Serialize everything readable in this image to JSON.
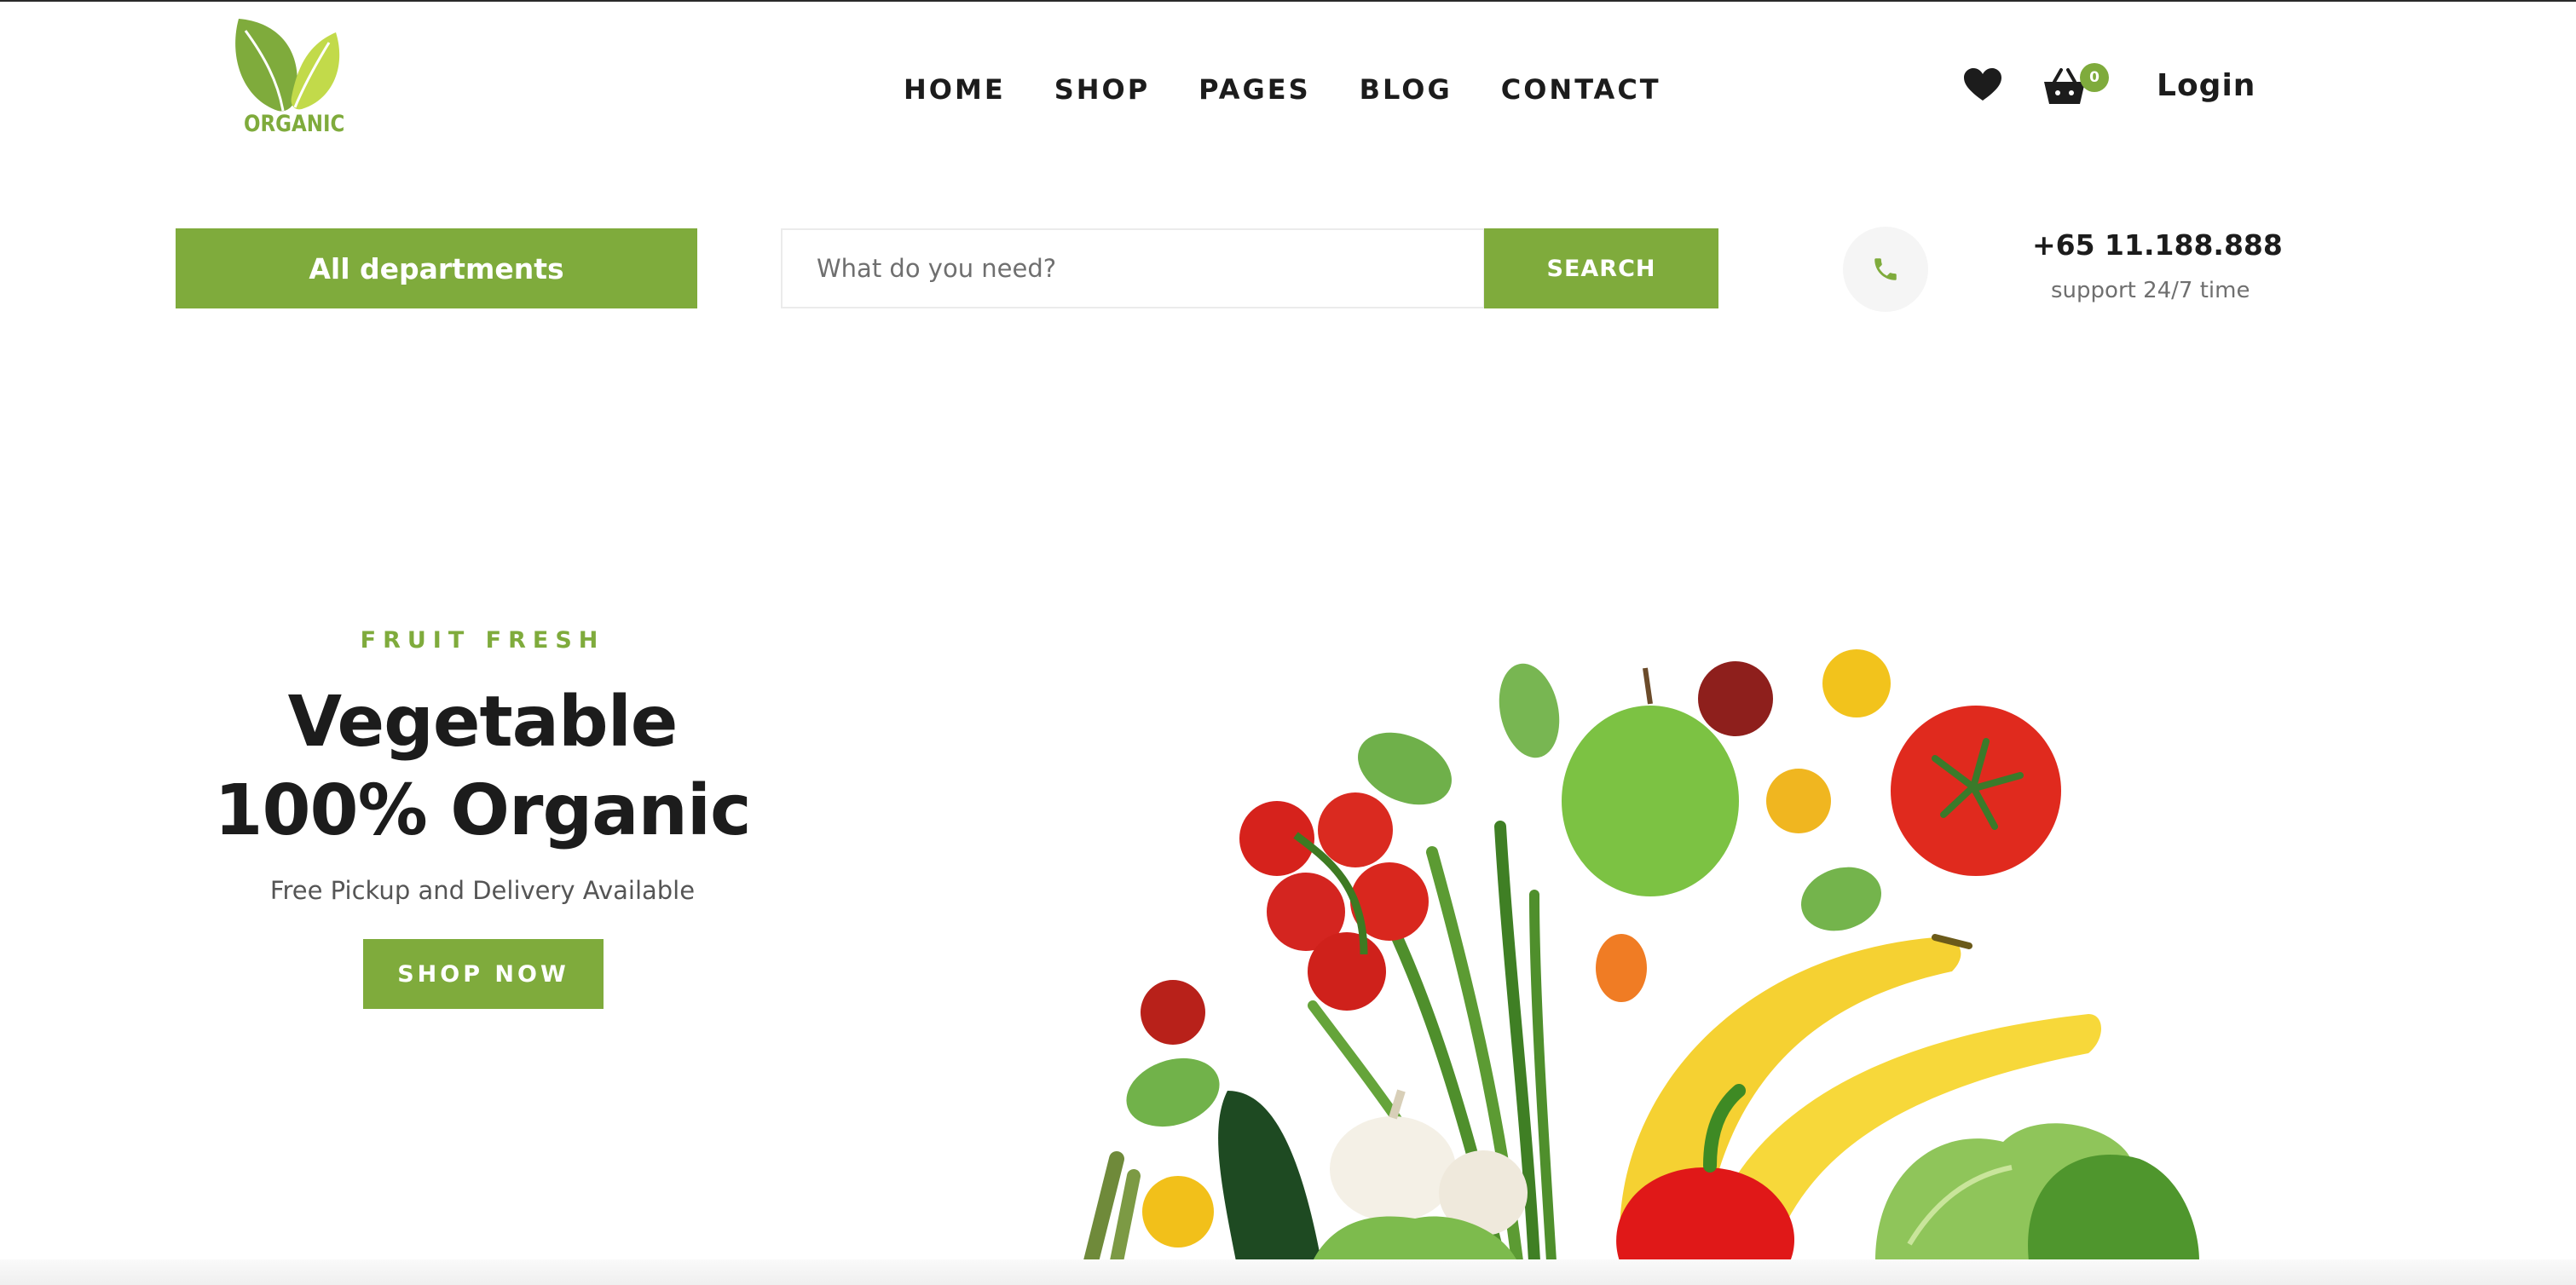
{
  "brand": {
    "logo_text": "ORGANIC",
    "logo_icon": "leaves-icon",
    "accent_color": "#7fab3c"
  },
  "nav": {
    "items": [
      {
        "label": "HOME"
      },
      {
        "label": "SHOP"
      },
      {
        "label": "PAGES"
      },
      {
        "label": "BLOG"
      },
      {
        "label": "CONTACT"
      }
    ]
  },
  "header_actions": {
    "wishlist_icon": "heart-icon",
    "cart_icon": "basket-icon",
    "cart_count": "0",
    "login_label": "Login"
  },
  "search": {
    "departments_label": "All departments",
    "placeholder": "What do you need?",
    "button_label": "SEARCH"
  },
  "contact": {
    "phone_icon": "phone-icon",
    "phone_number": "+65 11.188.888",
    "support_text": "support 24/7 time"
  },
  "hero": {
    "kicker": "FRUIT FRESH",
    "title_line1": "Vegetable",
    "title_line2": "100% Organic",
    "subtitle": "Free Pickup and Delivery Available",
    "cta_label": "SHOP NOW",
    "image": "fruits-vegetables-image"
  }
}
